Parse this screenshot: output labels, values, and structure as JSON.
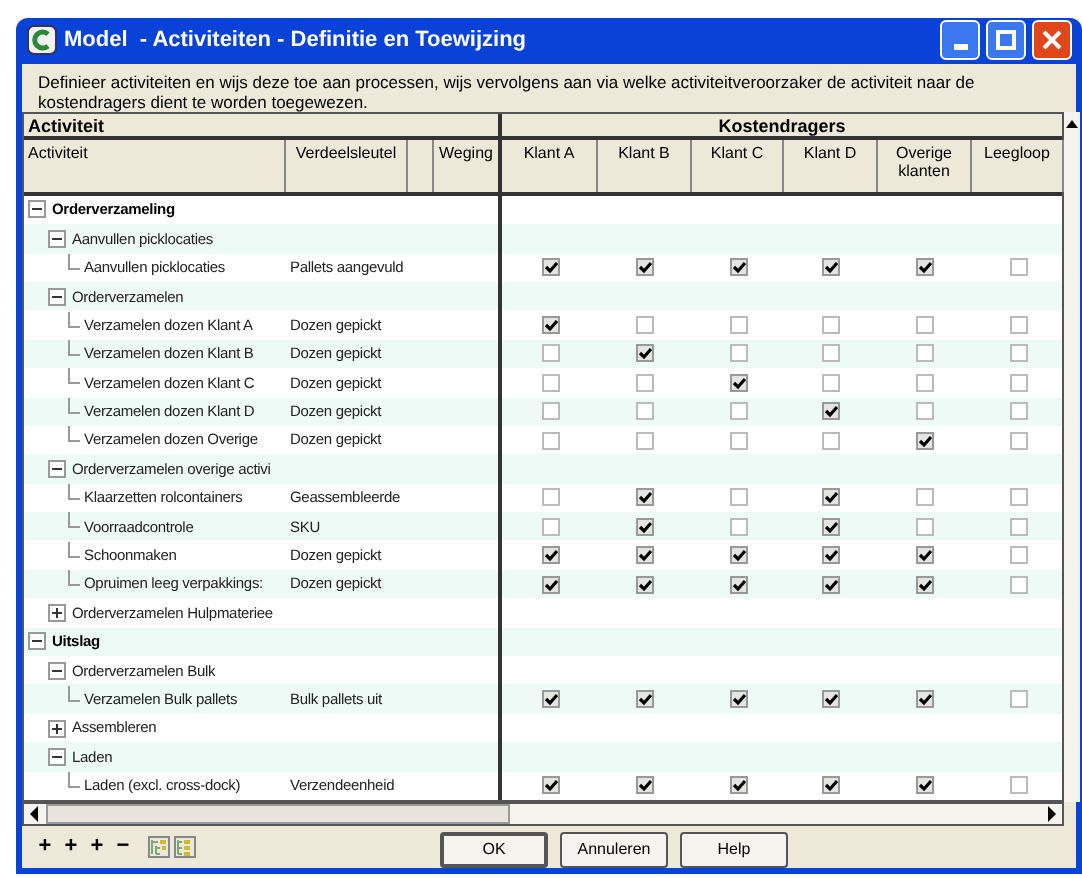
{
  "window": {
    "title": "Model  - Activiteiten - Definitie en Toewijzing"
  },
  "description": "Definieer activiteiten en wijs deze toe aan processen, wijs vervolgens aan via welke activiteitveroorzaker de activiteit naar de kostendragers dient te worden toegewezen.",
  "table": {
    "group_headers": [
      "Activiteit",
      "Kostendragers"
    ],
    "columns": [
      "Activiteit",
      "Verdeelsleutel",
      "",
      "Weging",
      "Klant A",
      "Klant B",
      "Klant C",
      "Klant D",
      "Overige klanten",
      "Leegloop"
    ],
    "rows": [
      {
        "label": "Orderverzameling",
        "kind": "section",
        "expanded": true,
        "children": [
          {
            "label": "Aanvullen picklocaties",
            "kind": "group",
            "expanded": true,
            "children": [
              {
                "label": "Aanvullen picklocaties",
                "kind": "activity",
                "verdeelsleutel": "Pallets aangevuld",
                "assignments": [
                  {
                    "checked": true
                  },
                  {
                    "checked": true
                  },
                  {
                    "checked": true
                  },
                  {
                    "checked": true
                  },
                  {
                    "checked": true
                  },
                  {
                    "checked": false
                  }
                ]
              }
            ]
          },
          {
            "label": "Orderverzamelen",
            "kind": "group",
            "expanded": true,
            "children": [
              {
                "label": "Verzamelen dozen Klant A",
                "kind": "activity",
                "verdeelsleutel": "Dozen gepickt",
                "assignments": [
                  {
                    "checked": true
                  },
                  {
                    "checked": false
                  },
                  {
                    "checked": false
                  },
                  {
                    "checked": false
                  },
                  {
                    "checked": false
                  },
                  {
                    "checked": false
                  }
                ]
              },
              {
                "label": "Verzamelen dozen Klant B",
                "kind": "activity",
                "verdeelsleutel": "Dozen gepickt",
                "assignments": [
                  {
                    "checked": false
                  },
                  {
                    "checked": true
                  },
                  {
                    "checked": false
                  },
                  {
                    "checked": false
                  },
                  {
                    "checked": false
                  },
                  {
                    "checked": false
                  }
                ]
              },
              {
                "label": "Verzamelen dozen Klant C",
                "kind": "activity",
                "verdeelsleutel": "Dozen gepickt",
                "assignments": [
                  {
                    "checked": false
                  },
                  {
                    "checked": false
                  },
                  {
                    "checked": true
                  },
                  {
                    "checked": false
                  },
                  {
                    "checked": false
                  },
                  {
                    "checked": false
                  }
                ]
              },
              {
                "label": "Verzamelen dozen Klant D",
                "kind": "activity",
                "verdeelsleutel": "Dozen gepickt",
                "assignments": [
                  {
                    "checked": false
                  },
                  {
                    "checked": false
                  },
                  {
                    "checked": false
                  },
                  {
                    "checked": true
                  },
                  {
                    "checked": false
                  },
                  {
                    "checked": false
                  }
                ]
              },
              {
                "label": "Verzamelen dozen Overige",
                "kind": "activity",
                "verdeelsleutel": "Dozen gepickt",
                "assignments": [
                  {
                    "checked": false
                  },
                  {
                    "checked": false
                  },
                  {
                    "checked": false
                  },
                  {
                    "checked": false
                  },
                  {
                    "checked": true
                  },
                  {
                    "checked": false
                  }
                ]
              }
            ]
          },
          {
            "label": "Orderverzamelen overige activi",
            "kind": "group",
            "expanded": true,
            "children": [
              {
                "label": "Klaarzetten rolcontainers",
                "kind": "activity",
                "verdeelsleutel": "Geassembleerde",
                "assignments": [
                  {
                    "checked": false
                  },
                  {
                    "checked": true
                  },
                  {
                    "checked": false
                  },
                  {
                    "checked": true
                  },
                  {
                    "checked": false
                  },
                  {
                    "checked": false
                  }
                ]
              },
              {
                "label": "Voorraadcontrole",
                "kind": "activity",
                "verdeelsleutel": "SKU",
                "assignments": [
                  {
                    "checked": false
                  },
                  {
                    "checked": true
                  },
                  {
                    "checked": false
                  },
                  {
                    "checked": true
                  },
                  {
                    "checked": false
                  },
                  {
                    "checked": false
                  }
                ]
              },
              {
                "label": "Schoonmaken",
                "kind": "activity",
                "verdeelsleutel": "Dozen gepickt",
                "assignments": [
                  {
                    "checked": true
                  },
                  {
                    "checked": true
                  },
                  {
                    "checked": true
                  },
                  {
                    "checked": true
                  },
                  {
                    "checked": true
                  },
                  {
                    "checked": false
                  }
                ]
              },
              {
                "label": "Opruimen leeg verpakkings:",
                "kind": "activity",
                "verdeelsleutel": "Dozen gepickt",
                "assignments": [
                  {
                    "checked": true
                  },
                  {
                    "checked": true
                  },
                  {
                    "checked": true
                  },
                  {
                    "checked": true
                  },
                  {
                    "checked": true
                  },
                  {
                    "checked": false
                  }
                ]
              }
            ]
          },
          {
            "label": "Orderverzamelen Hulpmateriee",
            "kind": "group",
            "expanded": false
          }
        ]
      },
      {
        "label": "Uitslag",
        "kind": "section",
        "expanded": true,
        "children": [
          {
            "label": "Orderverzamelen Bulk",
            "kind": "group",
            "expanded": true,
            "children": [
              {
                "label": "Verzamelen Bulk pallets",
                "kind": "activity",
                "verdeelsleutel": "Bulk pallets uit",
                "assignments": [
                  {
                    "checked": true
                  },
                  {
                    "checked": true
                  },
                  {
                    "checked": true
                  },
                  {
                    "checked": true
                  },
                  {
                    "checked": true
                  },
                  {
                    "checked": false
                  }
                ]
              }
            ]
          },
          {
            "label": "Assembleren",
            "kind": "group",
            "expanded": false
          },
          {
            "label": "Laden",
            "kind": "group",
            "expanded": true,
            "children": [
              {
                "label": "Laden (excl. cross-dock)",
                "kind": "activity",
                "verdeelsleutel": "Verzendeenheid",
                "assignments": [
                  {
                    "checked": true
                  },
                  {
                    "checked": true
                  },
                  {
                    "checked": true
                  },
                  {
                    "checked": true
                  },
                  {
                    "checked": true
                  },
                  {
                    "checked": false
                  }
                ]
              }
            ]
          }
        ]
      }
    ]
  },
  "toolbar": [
    {
      "kind": "text",
      "label": "+"
    },
    {
      "kind": "text",
      "label": "+"
    },
    {
      "kind": "text",
      "label": "+"
    },
    {
      "kind": "text",
      "label": "−"
    },
    {
      "kind": "expand"
    },
    {
      "kind": "collapse"
    }
  ],
  "buttons": [
    "OK",
    "Annuleren",
    "Help"
  ]
}
